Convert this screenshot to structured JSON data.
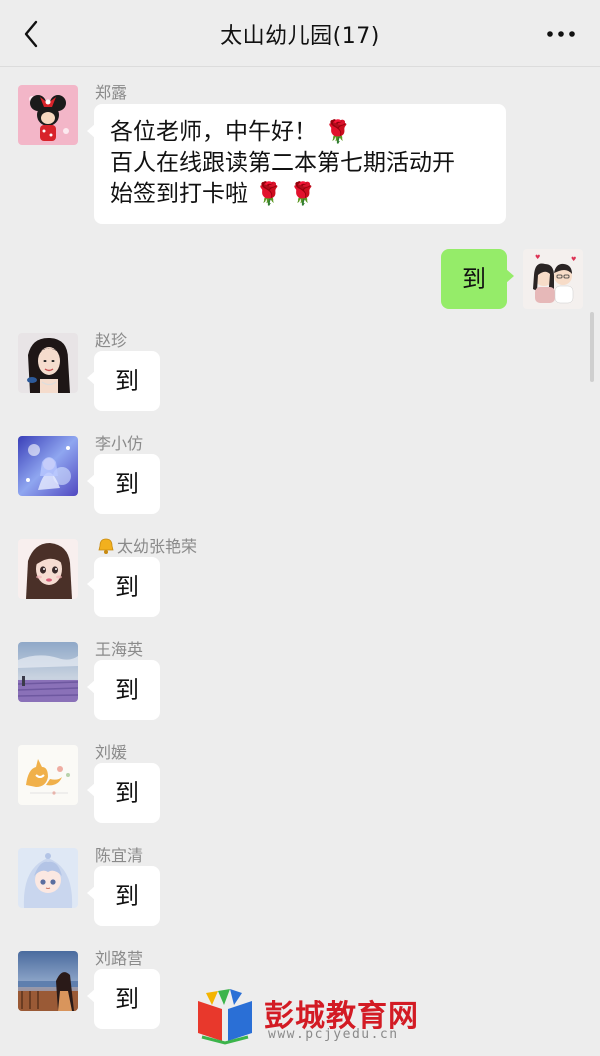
{
  "header": {
    "title": "太山幼儿园(17)",
    "back_icon": "chevron-left-icon",
    "more_icon": "ellipsis-icon"
  },
  "messages": [
    {
      "sender": "郑露",
      "lines": [
        "各位老师，中午好！",
        "百人在线跟读第二本第七期活动开",
        "始签到打卡啦"
      ],
      "emoji": "rose"
    },
    {
      "mine": true,
      "text": "到"
    },
    {
      "sender": "赵珍",
      "text": "到"
    },
    {
      "sender": "李小仿",
      "text": "到"
    },
    {
      "sender": "太幼张艳荣",
      "sender_icon": "bell-icon",
      "text": "到"
    },
    {
      "sender": "王海英",
      "text": "到"
    },
    {
      "sender": "刘媛",
      "text": "到"
    },
    {
      "sender": "陈宜清",
      "text": "到"
    },
    {
      "sender": "刘路营",
      "text": "到"
    }
  ],
  "watermark": {
    "title": "彭城教育网",
    "url": "www.pcjyedu.cn"
  },
  "colors": {
    "background": "#ededed",
    "bubble_incoming": "#ffffff",
    "bubble_outgoing": "#95ec69",
    "rose": "#c0132a",
    "watermark": "#d31b24"
  }
}
